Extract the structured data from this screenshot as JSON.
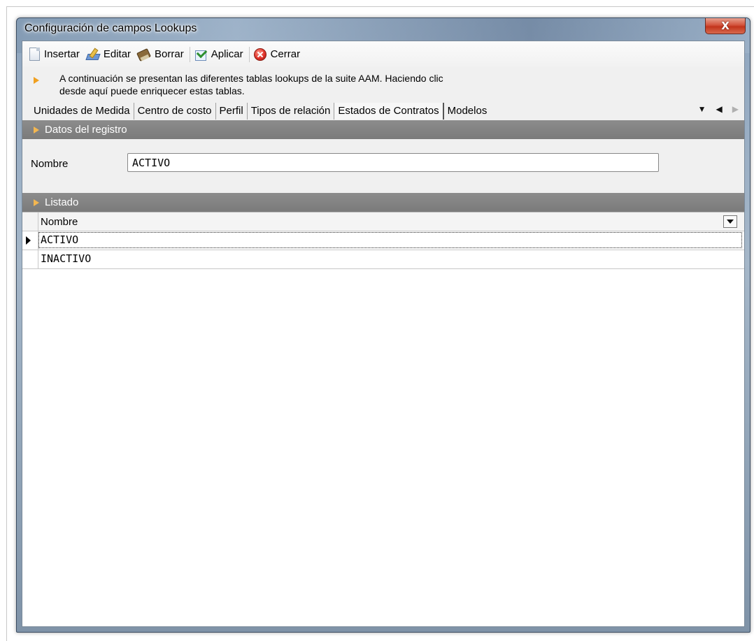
{
  "window": {
    "title": "Configuración de campos Lookups",
    "close_glyph": "X"
  },
  "toolbar": {
    "items": [
      {
        "label": "Insertar",
        "icon": "new-document-icon"
      },
      {
        "label": "Editar",
        "icon": "edit-icon"
      },
      {
        "label": "Borrar",
        "icon": "eraser-icon"
      },
      {
        "label": "Aplicar",
        "icon": "apply-check-icon"
      },
      {
        "label": "Cerrar",
        "icon": "close-circle-icon"
      }
    ]
  },
  "info": {
    "line1": "A continuación se presentan las diferentes tablas lookups de la suite AAM. Haciendo clic",
    "line2": "desde aquí puede enriquecer estas tablas."
  },
  "tabs": {
    "items": [
      "Unidades de Medida",
      "Centro de costo",
      "Perfil",
      "Tipos de relación",
      "Estados de Contratos",
      "Modelos"
    ],
    "active_index": 4
  },
  "record_section": {
    "title": "Datos del registro",
    "name_label": "Nombre",
    "name_value": "ACTIVO"
  },
  "list_section": {
    "title": "Listado",
    "column_header": "Nombre",
    "rows": [
      "ACTIVO",
      "INACTIVO"
    ],
    "selected_row": 0
  },
  "colors": {
    "section_header_bg": "#7f7f7f",
    "accent_arrow": "#f0a020",
    "close_button": "#c7402b"
  }
}
